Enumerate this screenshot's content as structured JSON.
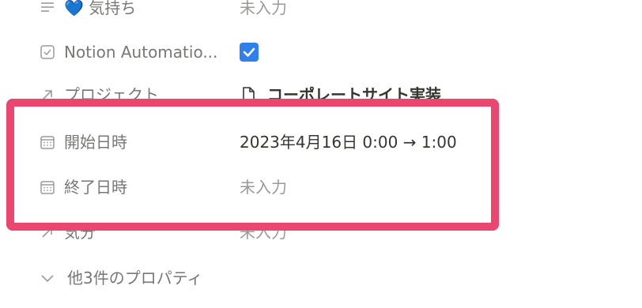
{
  "properties": {
    "mood": {
      "label": "💙 気持ち",
      "value": "未入力",
      "icon": "text-lines-icon"
    },
    "automation": {
      "label": "Notion Automatio...",
      "checked": true,
      "icon": "checkbox-icon"
    },
    "project": {
      "label": "プロジェクト",
      "value": "コーポレートサイト実装",
      "icon": "relation-arrow-icon",
      "page_icon": "document-icon"
    },
    "start": {
      "label": "開始日時",
      "value": "2023年4月16日 0:00 → 1:00",
      "icon": "calendar-icon"
    },
    "end": {
      "label": "終了日時",
      "value": "未入力",
      "icon": "calendar-icon"
    },
    "feeling": {
      "label": "気分",
      "value": "未入力",
      "icon": "relation-arrow-icon"
    }
  },
  "more": {
    "label": "他3件のプロパティ",
    "icon": "chevron-down-icon"
  },
  "colors": {
    "highlight_border": "#eb466f",
    "checkbox_blue": "#2f80ed",
    "label_gray": "#787774",
    "empty_gray": "#9b9a97",
    "text": "#37352f"
  }
}
